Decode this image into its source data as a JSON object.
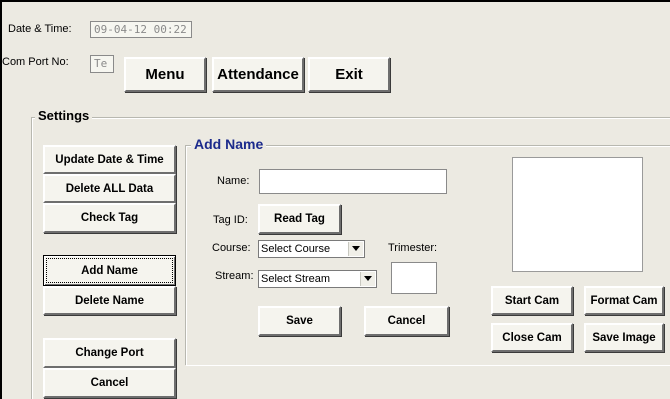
{
  "top": {
    "datetime_label": "Date & Time:",
    "datetime_value": "09-04-12 00:22",
    "comport_label": "Com Port No:",
    "comport_value": "Te"
  },
  "nav": {
    "menu": "Menu",
    "attendance": "Attendance",
    "exit": "Exit"
  },
  "settings": {
    "title": "Settings",
    "update_datetime": "Update Date & Time",
    "delete_all": "Delete ALL Data",
    "check_tag": "Check Tag",
    "add_name": "Add Name",
    "delete_name": "Delete Name",
    "change_port": "Change Port",
    "cancel": "Cancel"
  },
  "add_name": {
    "title": "Add Name",
    "name_label": "Name:",
    "name_value": "",
    "tagid_label": "Tag ID:",
    "read_tag": "Read Tag",
    "course_label": "Course:",
    "course_selected": "Select Course",
    "trimester_label": "Trimester:",
    "trimester_value": "",
    "stream_label": "Stream:",
    "stream_selected": "Select Stream",
    "save": "Save",
    "cancel": "Cancel"
  },
  "camera": {
    "start_cam": "Start Cam",
    "format_cam": "Format Cam",
    "close_cam": "Close Cam",
    "save_image": "Save Image"
  },
  "colors": {
    "background": "#eceae2",
    "group_title": "#1b2a8c"
  }
}
